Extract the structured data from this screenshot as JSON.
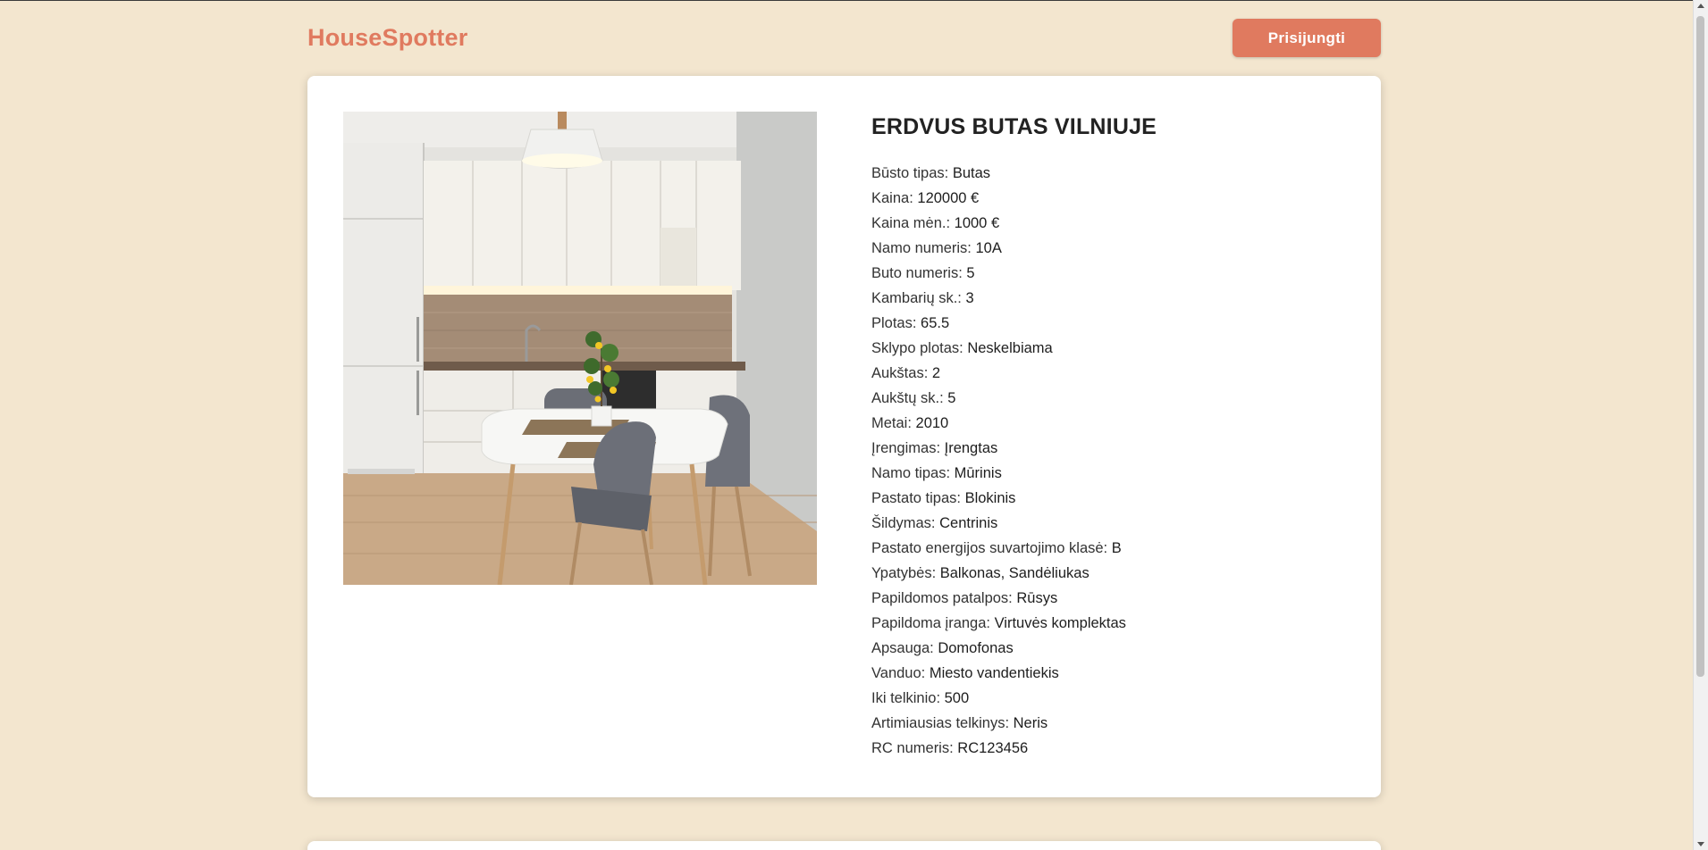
{
  "header": {
    "logo": "HouseSpotter",
    "login_label": "Prisijungti",
    "accent_color": "#e07a5f"
  },
  "listing": {
    "photo_icon": "kitchen-photo",
    "title": "ERDVUS BUTAS VILNIUJE",
    "properties": [
      {
        "label": "Būsto tipas:",
        "value": "Butas"
      },
      {
        "label": "Kaina:",
        "value": "120000 €"
      },
      {
        "label": "Kaina mėn.:",
        "value": "1000 €"
      },
      {
        "label": "Namo numeris:",
        "value": "10A"
      },
      {
        "label": "Buto numeris:",
        "value": "5"
      },
      {
        "label": "Kambarių sk.:",
        "value": "3"
      },
      {
        "label": "Plotas:",
        "value": "65.5"
      },
      {
        "label": "Sklypo plotas:",
        "value": "Neskelbiama"
      },
      {
        "label": "Aukštas:",
        "value": "2"
      },
      {
        "label": "Aukštų sk.:",
        "value": "5"
      },
      {
        "label": "Metai:",
        "value": "2010"
      },
      {
        "label": "Įrengimas:",
        "value": "Įrengtas"
      },
      {
        "label": "Namo tipas:",
        "value": "Mūrinis"
      },
      {
        "label": "Pastato tipas:",
        "value": "Blokinis"
      },
      {
        "label": "Šildymas:",
        "value": "Centrinis"
      },
      {
        "label": "Pastato energijos suvartojimo klasė:",
        "value": "B"
      },
      {
        "label": "Ypatybės:",
        "value": "Balkonas, Sandėliukas"
      },
      {
        "label": "Papildomos patalpos:",
        "value": "Rūsys"
      },
      {
        "label": "Papildoma įranga:",
        "value": "Virtuvės komplektas"
      },
      {
        "label": "Apsauga:",
        "value": "Domofonas"
      },
      {
        "label": "Vanduo:",
        "value": "Miesto vandentiekis"
      },
      {
        "label": "Iki telkinio:",
        "value": "500"
      },
      {
        "label": "Artimiausias telkinys:",
        "value": "Neris"
      },
      {
        "label": "RC numeris:",
        "value": "RC123456"
      }
    ]
  }
}
